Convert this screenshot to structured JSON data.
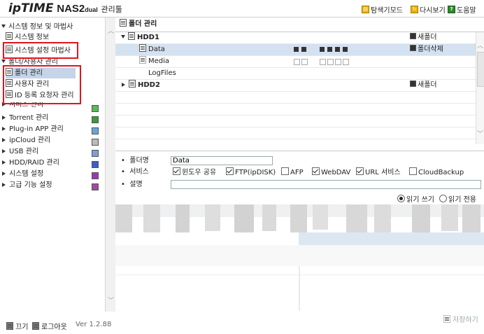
{
  "header": {
    "logo_brand": "ipTIME",
    "logo_model": "NAS2",
    "logo_dual": "dual",
    "logo_suffix": "관리툴",
    "links": [
      {
        "label": "탐색기모드",
        "icon": "explorer-icon"
      },
      {
        "label": "다시보기",
        "icon": "refresh-icon"
      },
      {
        "label": "도움말",
        "icon": "help-icon"
      }
    ]
  },
  "sidebar": {
    "sections": [
      {
        "label": "시스템 정보 및 마법사",
        "expanded": true
      },
      {
        "label": "시스템 정보"
      },
      {
        "label": "시스템 설정 마법사"
      },
      {
        "label": "폴더/사용자 관리",
        "expanded": true
      },
      {
        "label": "폴더 관리"
      },
      {
        "label": "사용자 관리"
      },
      {
        "label": "ID 등록 요청자 관리"
      },
      {
        "label": "서비스 관리"
      },
      {
        "label": "Torrent 관리"
      },
      {
        "label": "Plug-in APP 관리"
      },
      {
        "label": "ipCloud 관리"
      },
      {
        "label": "USB 관리"
      },
      {
        "label": "HDD/RAID 관리"
      },
      {
        "label": "시스템 설정"
      },
      {
        "label": "고급 기능 설정"
      }
    ]
  },
  "footer": {
    "exit_label": "끄기",
    "logout_label": "로그아웃",
    "version": "Ver 1.2.88"
  },
  "panel": {
    "title": "폴더 관리",
    "tree": {
      "disks": [
        {
          "name": "HDD1",
          "action": "새폴더",
          "folders": [
            {
              "name": "Data",
              "action": "폴더삭제",
              "selected": true
            },
            {
              "name": "Media"
            },
            {
              "name": "LogFiles"
            }
          ]
        },
        {
          "name": "HDD2",
          "action": "새폴더",
          "folders": []
        }
      ]
    },
    "form": {
      "folder_name_label": "폴더명",
      "folder_name_value": "Data",
      "services_label": "서비스",
      "services": [
        {
          "label": "윈도우 공유",
          "checked": true
        },
        {
          "label": "FTP(ipDISK)",
          "checked": true
        },
        {
          "label": "AFP",
          "checked": false
        },
        {
          "label": "WebDAV",
          "checked": true
        },
        {
          "label": "URL 서비스",
          "checked": true
        },
        {
          "label": "CloudBackup",
          "checked": false
        }
      ],
      "description_label": "설명",
      "description_value": "",
      "access_options": [
        {
          "label": "읽기 쓰기",
          "selected": true
        },
        {
          "label": "읽기 전용",
          "selected": false
        }
      ]
    },
    "save_label": "저장하기"
  },
  "colors": {
    "highlight": "#e0141e",
    "selection": "#d4e1f1"
  }
}
